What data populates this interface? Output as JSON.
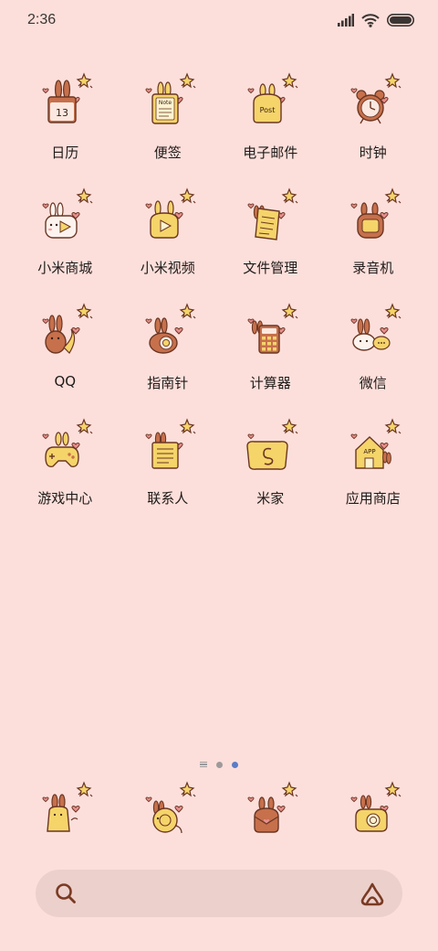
{
  "status_bar": {
    "time": "2:36",
    "icons": [
      "signal-icon",
      "wifi-icon",
      "battery-icon"
    ]
  },
  "apps": [
    {
      "label": "日历",
      "icon": "calendar-icon",
      "icon_text": "13"
    },
    {
      "label": "便签",
      "icon": "notes-icon",
      "icon_text": "Note"
    },
    {
      "label": "电子邮件",
      "icon": "email-icon",
      "icon_text": "Post"
    },
    {
      "label": "时钟",
      "icon": "clock-icon"
    },
    {
      "label": "小米商城",
      "icon": "mi-store-icon"
    },
    {
      "label": "小米视频",
      "icon": "mi-video-icon"
    },
    {
      "label": "文件管理",
      "icon": "file-manager-icon"
    },
    {
      "label": "录音机",
      "icon": "recorder-icon"
    },
    {
      "label": "QQ",
      "icon": "qq-icon"
    },
    {
      "label": "指南针",
      "icon": "compass-icon"
    },
    {
      "label": "计算器",
      "icon": "calculator-icon"
    },
    {
      "label": "微信",
      "icon": "wechat-icon"
    },
    {
      "label": "游戏中心",
      "icon": "game-center-icon"
    },
    {
      "label": "联系人",
      "icon": "contacts-icon"
    },
    {
      "label": "米家",
      "icon": "mijia-icon"
    },
    {
      "label": "应用商店",
      "icon": "app-store-icon",
      "icon_text": "APP"
    }
  ],
  "page_indicator": {
    "pages": 2,
    "active_page": 2
  },
  "dock": [
    {
      "icon": "phone-icon"
    },
    {
      "icon": "messages-icon"
    },
    {
      "icon": "browser-icon"
    },
    {
      "icon": "camera-icon"
    }
  ],
  "search_bar": {
    "left_icon": "search-icon",
    "right_icon": "assistant-icon"
  },
  "colors": {
    "background": "#fcdfdb",
    "search_bar": "#ecd0cb",
    "icon_brown": "#a25a3c",
    "icon_yellow": "#f5d46a",
    "active_dot": "#5a7cc8"
  }
}
